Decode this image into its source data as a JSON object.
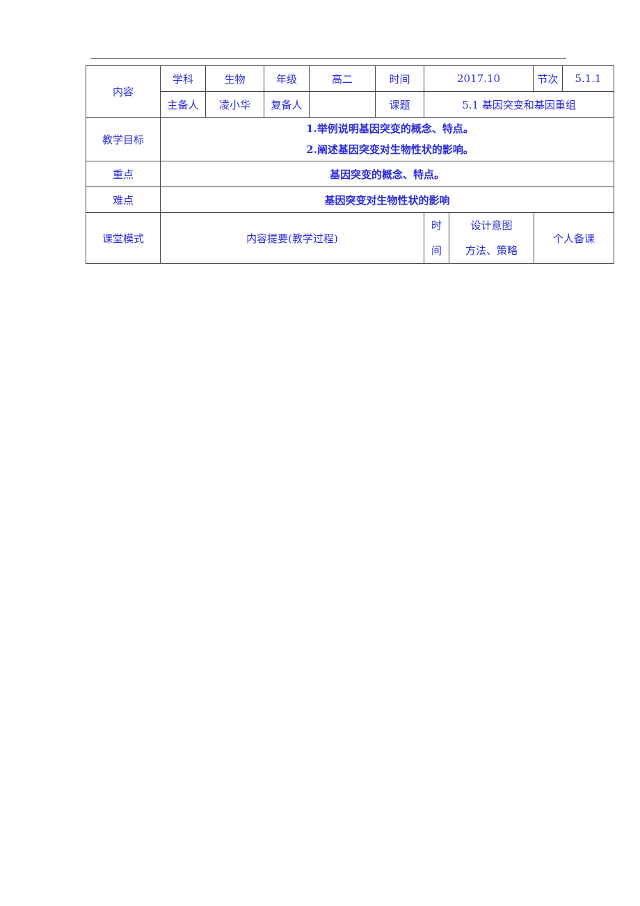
{
  "header": {
    "content_label": "内容",
    "subject_label": "学科",
    "subject_value": "生物",
    "grade_label": "年级",
    "grade_value": "高二",
    "time_label": "时间",
    "time_value": "2017.10",
    "section_label": "节次",
    "section_value": "5.1.1",
    "lead_preparer_label": "主备人",
    "lead_preparer_value": "凌小华",
    "co_preparer_label": "复备人",
    "co_preparer_value": "",
    "topic_label": "课题",
    "topic_value": "5.1 基因突变和基因重组"
  },
  "objectives": {
    "label": "教学目标",
    "items": [
      "1.举例说明基因突变的概念、特点。",
      "2.阐述基因突变对生物性状的影响。"
    ]
  },
  "key_point": {
    "label": "重点",
    "value": "基因突变的概念、特点。"
  },
  "difficult_point": {
    "label": "难点",
    "value": "基因突变对生物性状的影响"
  },
  "process_header": {
    "mode_label": "课堂模式",
    "content_label": "内容提要(教学过程)",
    "time_label_1": "时",
    "time_label_2": "间",
    "design_label_1": "设计意图",
    "design_label_2": "方法、策略",
    "personal_label": "个人备课"
  }
}
